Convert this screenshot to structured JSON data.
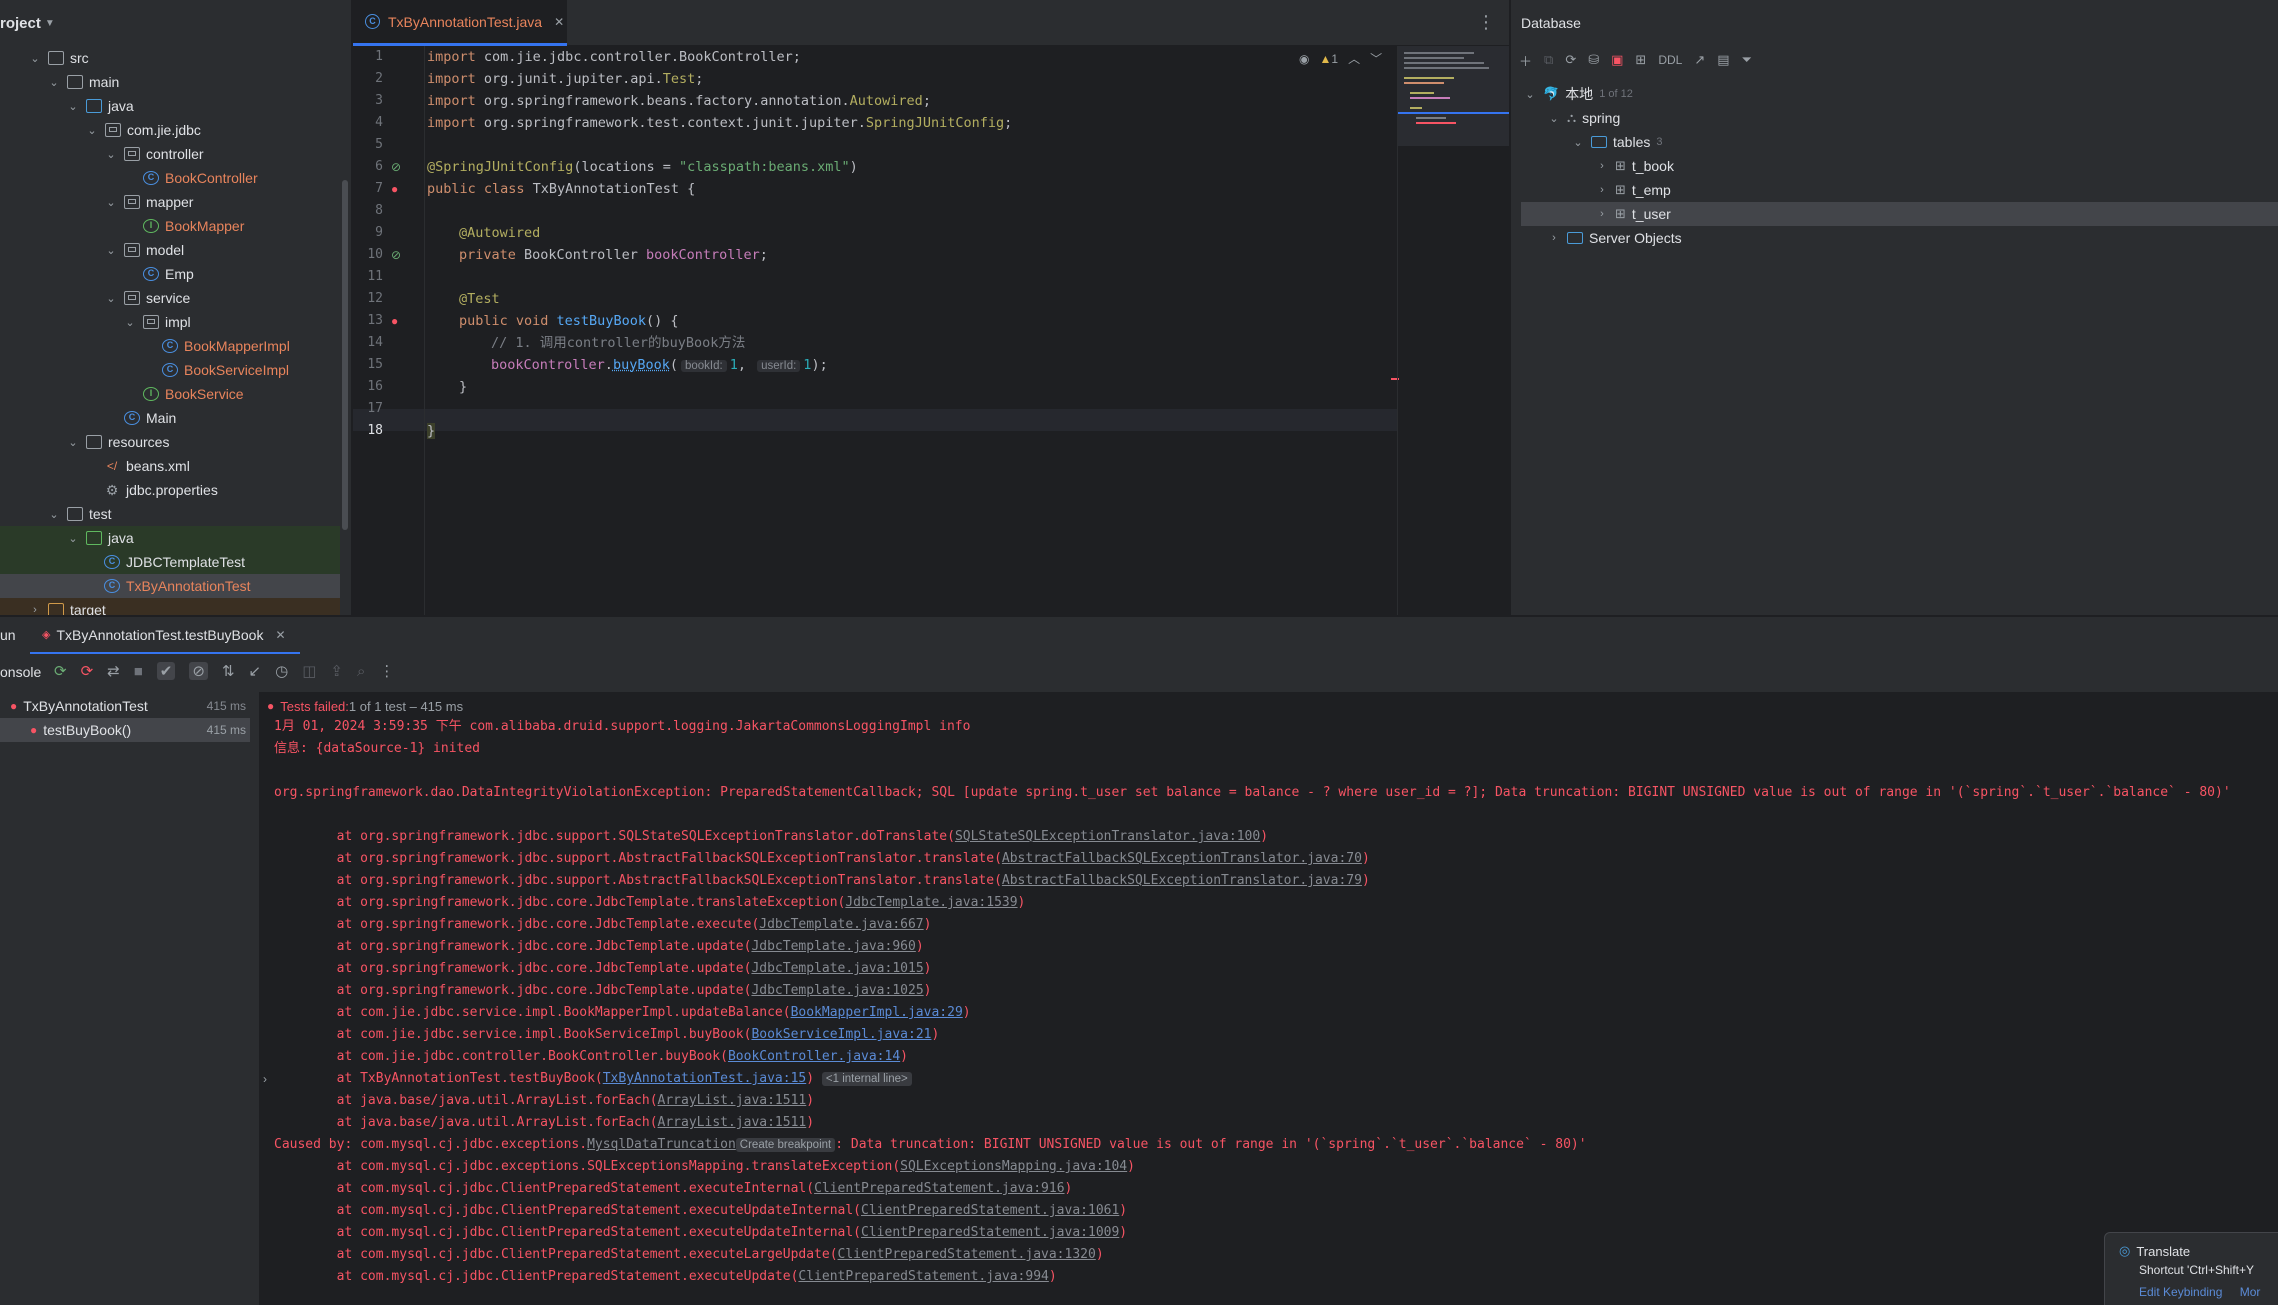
{
  "project": {
    "header": "roject",
    "tree": [
      {
        "label": "src"
      },
      {
        "label": "main"
      },
      {
        "label": "java"
      },
      {
        "label": "com.jie.jdbc"
      },
      {
        "label": "controller"
      },
      {
        "label": "BookController"
      },
      {
        "label": "mapper"
      },
      {
        "label": "BookMapper"
      },
      {
        "label": "model"
      },
      {
        "label": "Emp"
      },
      {
        "label": "service"
      },
      {
        "label": "impl"
      },
      {
        "label": "BookMapperImpl"
      },
      {
        "label": "BookServiceImpl"
      },
      {
        "label": "BookService"
      },
      {
        "label": "Main"
      },
      {
        "label": "resources"
      },
      {
        "label": "beans.xml"
      },
      {
        "label": "jdbc.properties"
      },
      {
        "label": "test"
      },
      {
        "label": "java"
      },
      {
        "label": "JDBCTemplateTest"
      },
      {
        "label": "TxByAnnotationTest"
      },
      {
        "label": "target"
      }
    ]
  },
  "editor": {
    "tab_label": "TxByAnnotationTest.java",
    "warning_count": "1",
    "lines": {
      "l1": [
        "import",
        " com.jie.jdbc.controller.BookController;"
      ],
      "l2": [
        "import",
        " org.junit.jupiter.api.",
        "Test",
        ";"
      ],
      "l3": [
        "import",
        " org.springframework.beans.factory.annotation.",
        "Autowired",
        ";"
      ],
      "l4": [
        "import",
        " org.springframework.test.context.junit.jupiter.",
        "SpringJUnitConfig",
        ";"
      ],
      "l6": [
        "@SpringJUnitConfig",
        "(locations = ",
        "\"classpath:beans.xml\"",
        ")"
      ],
      "l7": [
        "public class",
        " TxByAnnotationTest {"
      ],
      "l9": [
        "@Autowired"
      ],
      "l10": [
        "private",
        " BookController ",
        "bookController",
        ";"
      ],
      "l12": [
        "@Test"
      ],
      "l13": [
        "public void",
        " ",
        "testBuyBook",
        "() {"
      ],
      "l14": [
        "// 1. 调用controller的buyBook方法"
      ],
      "l15": [
        "bookController",
        ".",
        "buyBook",
        "(",
        "bookId:",
        "1",
        ", ",
        "userId:",
        "1",
        ");"
      ],
      "l16": [
        "}"
      ],
      "l18": [
        "}"
      ]
    },
    "line_numbers": [
      "1",
      "2",
      "3",
      "4",
      "5",
      "6",
      "7",
      "8",
      "9",
      "10",
      "11",
      "12",
      "13",
      "14",
      "15",
      "16",
      "17",
      "18"
    ]
  },
  "database": {
    "title": "Database",
    "toolbar": {
      "ddl": "DDL"
    },
    "tree": {
      "root": "本地",
      "root_count": "1 of 12",
      "schema": "spring",
      "tables": "tables",
      "tables_count": "3",
      "t1": "t_book",
      "t2": "t_emp",
      "t3": "t_user",
      "server": "Server Objects"
    }
  },
  "run": {
    "tab_prefix": "un",
    "tab_label": "TxByAnnotationTest.testBuyBook",
    "console_label": "onsole",
    "tests": {
      "suite": "TxByAnnotationTest",
      "suite_time": "415 ms",
      "case": "testBuyBook()",
      "case_time": "415 ms"
    },
    "status": {
      "bold": "Tests failed:",
      "rest": " 1 of 1 test – 415 ms"
    },
    "console": {
      "l1": "1月 01, 2024 3:59:35 下午 com.alibaba.druid.support.logging.JakartaCommonsLoggingImpl info",
      "l2": "信息: {dataSource-1} inited",
      "l3": "org.springframework.dao.DataIntegrityViolationException: PreparedStatementCallback; SQL [update spring.t_user set balance = balance - ? where user_id = ?]; Data truncation: BIGINT UNSIGNED value is out of range in '(`spring`.`t_user`.`balance` - 80)'",
      "s1a": "\tat org.springframework.jdbc.support.SQLStateSQLExceptionTranslator.doTranslate(",
      "s1b": "SQLStateSQLExceptionTranslator.java:100",
      "s1c": ")",
      "s2a": "\tat org.springframework.jdbc.support.AbstractFallbackSQLExceptionTranslator.translate(",
      "s2b": "AbstractFallbackSQLExceptionTranslator.java:70",
      "s2c": ")",
      "s3a": "\tat org.springframework.jdbc.support.AbstractFallbackSQLExceptionTranslator.translate(",
      "s3b": "AbstractFallbackSQLExceptionTranslator.java:79",
      "s3c": ")",
      "s4a": "\tat org.springframework.jdbc.core.JdbcTemplate.translateException(",
      "s4b": "JdbcTemplate.java:1539",
      "s4c": ")",
      "s5a": "\tat org.springframework.jdbc.core.JdbcTemplate.execute(",
      "s5b": "JdbcTemplate.java:667",
      "s5c": ")",
      "s6a": "\tat org.springframework.jdbc.core.JdbcTemplate.update(",
      "s6b": "JdbcTemplate.java:960",
      "s6c": ")",
      "s7a": "\tat org.springframework.jdbc.core.JdbcTemplate.update(",
      "s7b": "JdbcTemplate.java:1015",
      "s7c": ")",
      "s8a": "\tat org.springframework.jdbc.core.JdbcTemplate.update(",
      "s8b": "JdbcTemplate.java:1025",
      "s8c": ")",
      "s9a": "\tat com.jie.jdbc.service.impl.BookMapperImpl.updateBalance(",
      "s9b": "BookMapperImpl.java:29",
      "s9c": ")",
      "s10a": "\tat com.jie.jdbc.service.impl.BookServiceImpl.buyBook(",
      "s10b": "BookServiceImpl.java:21",
      "s10c": ")",
      "s11a": "\tat com.jie.jdbc.controller.BookController.buyBook(",
      "s11b": "BookController.java:14",
      "s11c": ")",
      "s12a": "\tat TxByAnnotationTest.testBuyBook(",
      "s12b": "TxByAnnotationTest.java:15",
      "s12c": ")",
      "s12d": "<1 internal line>",
      "s13a": "\tat java.base/java.util.ArrayList.forEach(",
      "s13b": "ArrayList.java:1511",
      "s13c": ")",
      "s14a": "\tat java.base/java.util.ArrayList.forEach(",
      "s14b": "ArrayList.java:1511",
      "s14c": ")",
      "c1a": "Caused by: com.mysql.cj.jdbc.exceptions.",
      "c1b": "MysqlDataTruncation",
      "c1chip": "Create breakpoint",
      "c1c": ": Data truncation: BIGINT UNSIGNED value is out of range in '(`spring`.`t_user`.`balance` - 80)'",
      "m1a": "\tat com.mysql.cj.jdbc.exceptions.SQLExceptionsMapping.translateException(",
      "m1b": "SQLExceptionsMapping.java:104",
      "m1c": ")",
      "m2a": "\tat com.mysql.cj.jdbc.ClientPreparedStatement.executeInternal(",
      "m2b": "ClientPreparedStatement.java:916",
      "m2c": ")",
      "m3a": "\tat com.mysql.cj.jdbc.ClientPreparedStatement.executeUpdateInternal(",
      "m3b": "ClientPreparedStatement.java:1061",
      "m3c": ")",
      "m4a": "\tat com.mysql.cj.jdbc.ClientPreparedStatement.executeUpdateInternal(",
      "m4b": "ClientPreparedStatement.java:1009",
      "m4c": ")",
      "m5a": "\tat com.mysql.cj.jdbc.ClientPreparedStatement.executeLargeUpdate(",
      "m5b": "ClientPreparedStatement.java:1320",
      "m5c": ")",
      "m6a": "\tat com.mysql.cj.jdbc.ClientPreparedStatement.executeUpdate(",
      "m6b": "ClientPreparedStatement.java:994",
      "m6c": ")"
    }
  },
  "translate_popup": {
    "title": "Translate",
    "shortcut": "Shortcut 'Ctrl+Shift+Y",
    "edit_link": "Edit Keybinding",
    "more_link": "Mor"
  },
  "colors": {
    "accent": "#3574f0",
    "error": "#f75464",
    "link": "#5b8bd6"
  }
}
